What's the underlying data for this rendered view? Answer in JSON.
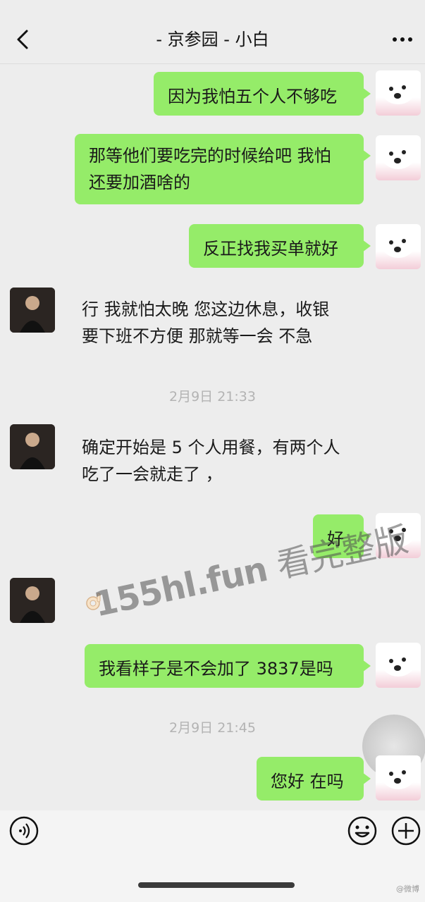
{
  "header": {
    "title": "- 京参园 - 小白"
  },
  "messages": [
    {
      "from": "me",
      "text": "因为我怕五个人不够吃"
    },
    {
      "from": "me",
      "lines": [
        "那等他们要吃完的时候给吧 我怕",
        "还要加酒啥的"
      ]
    },
    {
      "from": "me",
      "text": "反正找我买单就好"
    },
    {
      "from": "other",
      "lines": [
        "行  我就怕太晚  您这边休息，收银",
        "要下班不方便  那就等一会  不急"
      ]
    },
    {
      "timestamp": "2月9日 21:33"
    },
    {
      "from": "other",
      "lines": [
        "确定开始是 5 个人用餐，有两个人",
        "吃了一会就走了 ，"
      ]
    },
    {
      "from": "me",
      "text": "好"
    },
    {
      "from": "other",
      "emoji": "ok-hand"
    },
    {
      "from": "me",
      "text": "我看样子是不会加了 3837是吗"
    },
    {
      "timestamp": "2月9日 21:45"
    },
    {
      "from": "me",
      "text": "您好 在吗"
    }
  ],
  "watermark": {
    "site": "155hl.fun",
    "text": "看完整版"
  },
  "footer": {
    "credit": "@微博"
  },
  "colors": {
    "bubble_me": "#95ec69",
    "background": "#ededed"
  },
  "icons": [
    "back-arrow-icon",
    "more-icon",
    "voice-icon",
    "emoji-icon",
    "plus-icon"
  ]
}
